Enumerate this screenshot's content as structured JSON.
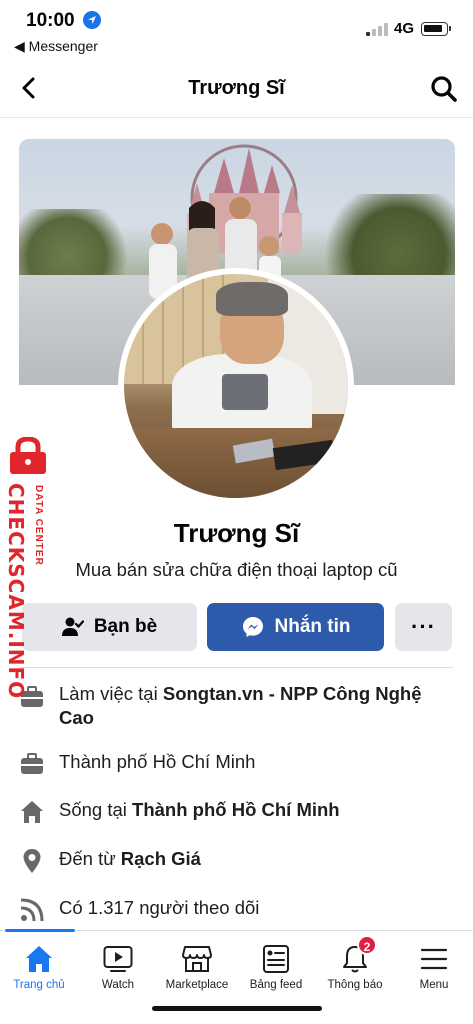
{
  "status_bar": {
    "time": "10:00",
    "back_app": "◀ Messenger",
    "network": "4G"
  },
  "header": {
    "title": "Trương Sĩ"
  },
  "profile": {
    "name": "Trương Sĩ",
    "bio": "Mua bán sửa chữa điện thoại laptop cũ"
  },
  "actions": {
    "friends_label": "Bạn bè",
    "message_label": "Nhắn tin",
    "more_label": "···"
  },
  "info": [
    {
      "icon": "briefcase-icon",
      "prefix": "Làm việc tại ",
      "bold": "Songtan.vn - NPP Công Nghệ Cao"
    },
    {
      "icon": "briefcase-icon",
      "prefix": "Thành phố Hồ Chí Minh",
      "bold": ""
    },
    {
      "icon": "home-icon",
      "prefix": "Sống tại ",
      "bold": "Thành phố Hồ Chí Minh"
    },
    {
      "icon": "location-pin-icon",
      "prefix": "Đến từ ",
      "bold": "Rạch Giá"
    },
    {
      "icon": "rss-icon",
      "prefix": "Có 1.317 người theo dõi",
      "bold": ""
    }
  ],
  "watermark": {
    "big": "CHECKSCAM.INFO",
    "small": "DATA CENTER"
  },
  "tabs": [
    {
      "label": "Trang chủ",
      "icon": "home-icon",
      "active": true
    },
    {
      "label": "Watch",
      "icon": "video-icon"
    },
    {
      "label": "Marketplace",
      "icon": "marketplace-icon"
    },
    {
      "label": "Bảng feed",
      "icon": "feed-icon"
    },
    {
      "label": "Thông báo",
      "icon": "bell-icon",
      "badge": "2"
    },
    {
      "label": "Menu",
      "icon": "menu-icon"
    }
  ],
  "colors": {
    "accent": "#1877f2",
    "message_button": "#2e5aac",
    "watermark": "#e0262b",
    "badge": "#e41e3f"
  }
}
